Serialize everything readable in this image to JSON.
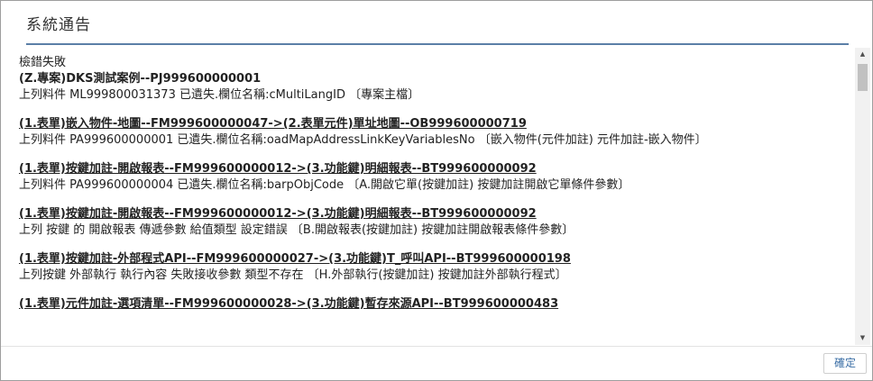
{
  "dialog": {
    "title": "系統通告"
  },
  "messages": {
    "line_0": "檢錯失敗",
    "line_1": "(Z.專案)DKS測試案例--PJ999600000001",
    "line_2": "上列料件 ML999800031373 已遺失.欄位名稱:cMultiLangID 〔專案主檔〕",
    "line_3": "(1.表單)嵌入物件-地圖--FM999600000047->(2.表單元件)單址地圖--OB999600000719",
    "line_4": "上列料件 PA999600000001 已遺失.欄位名稱:oadMapAddressLinkKeyVariablesNo 〔嵌入物件(元件加註) 元件加註-嵌入物件〕",
    "line_5": "(1.表單)按鍵加註-開啟報表--FM999600000012->(3.功能鍵)明細報表--BT999600000092",
    "line_6": "上列料件 PA999600000004 已遺失.欄位名稱:barpObjCode 〔A.開啟它單(按鍵加註) 按鍵加註開啟它單條件參數〕",
    "line_7": "(1.表單)按鍵加註-開啟報表--FM999600000012->(3.功能鍵)明細報表--BT999600000092",
    "line_8": "上列 按鍵 的 開啟報表 傳遞參數 給值類型 設定錯誤 〔B.開啟報表(按鍵加註) 按鍵加註開啟報表條件參數〕",
    "line_9": "(1.表單)按鍵加註-外部程式API--FM999600000027->(3.功能鍵)T_呼叫API--BT999600000198",
    "line_10": "上列按鍵 外部執行 執行內容 失敗接收參數 類型不存在 〔H.外部執行(按鍵加註) 按鍵加註外部執行程式〕",
    "line_11": "(1.表單)元件加註-選項清單--FM999600000028->(3.功能鍵)暫存來源API--BT999600000483"
  },
  "scrollbar": {
    "up_icon": "▲",
    "down_icon": "▼"
  },
  "footer": {
    "ok_label": "確定"
  }
}
